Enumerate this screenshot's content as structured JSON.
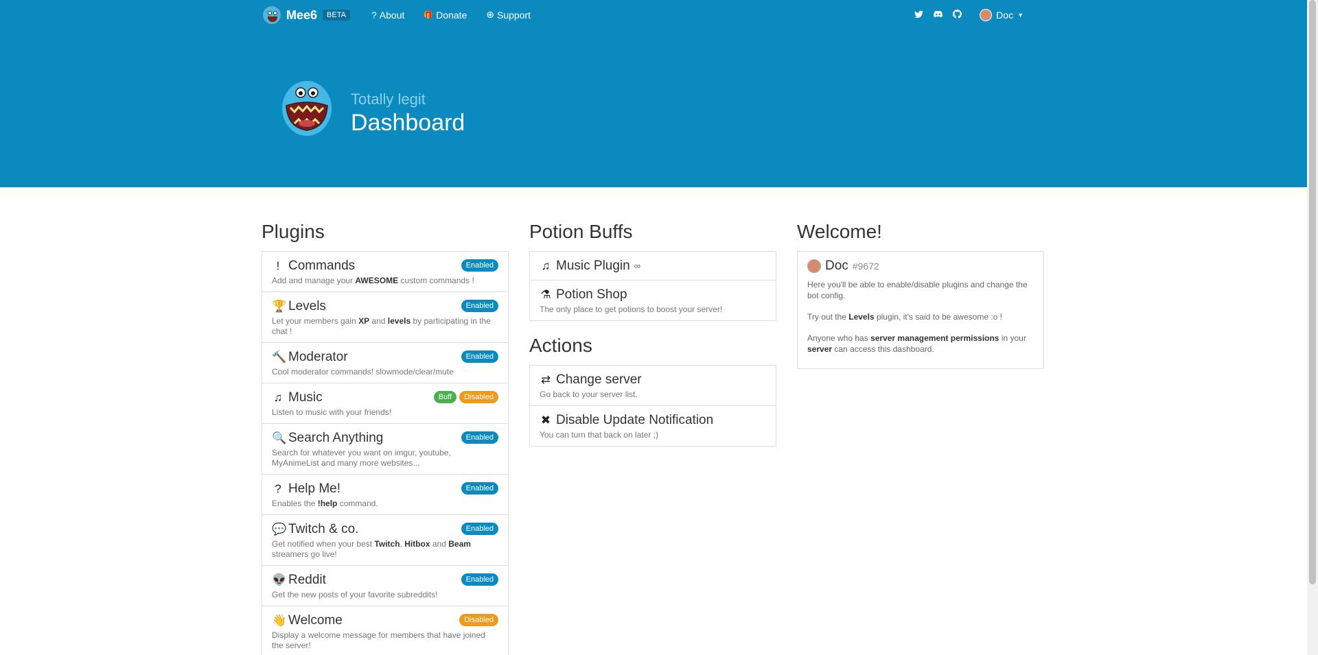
{
  "nav": {
    "brand": "Mee6",
    "beta": "BETA",
    "links": [
      {
        "icon": "?",
        "label": "About"
      },
      {
        "icon": "🎁",
        "label": "Donate"
      },
      {
        "icon": "⊕",
        "label": "Support"
      }
    ],
    "social_icons": [
      "twitter-icon",
      "discord-icon",
      "github-icon"
    ],
    "user": "Doc"
  },
  "hero": {
    "subtitle": "Totally legit",
    "title": "Dashboard"
  },
  "plugins": {
    "heading": "Plugins",
    "items": [
      {
        "icon": "!",
        "name": "Commands",
        "badges": [
          "Enabled"
        ],
        "desc_parts": [
          "Add and manage your ",
          "AWESOME",
          " custom commands !"
        ]
      },
      {
        "icon": "🏆",
        "name": "Levels",
        "badges": [
          "Enabled"
        ],
        "desc_parts": [
          "Let your members gain ",
          "XP",
          " and ",
          "levels",
          " by participating in the chat !"
        ]
      },
      {
        "icon": "🔨",
        "name": "Moderator",
        "badges": [
          "Enabled"
        ],
        "desc_parts": [
          "Cool moderator commands! slowmode/clear/mute"
        ]
      },
      {
        "icon": "♫",
        "name": "Music",
        "badges": [
          "Buff",
          "Disabled"
        ],
        "desc_parts": [
          "Listen to music with your friends!"
        ]
      },
      {
        "icon": "🔍",
        "name": "Search Anything",
        "badges": [
          "Enabled"
        ],
        "desc_parts": [
          "Search for whatever you want on imgur, youtube, MyAnimeList and many more websites..."
        ]
      },
      {
        "icon": "?",
        "name": "Help Me!",
        "badges": [
          "Enabled"
        ],
        "desc_parts": [
          "Enables the ",
          "!help",
          " command."
        ]
      },
      {
        "icon": "💬",
        "name": "Twitch & co.",
        "badges": [
          "Enabled"
        ],
        "desc_parts": [
          "Get notified when your best ",
          "Twitch",
          ", ",
          "Hitbox",
          " and ",
          "Beam",
          " streamers go live!"
        ]
      },
      {
        "icon": "👽",
        "name": "Reddit",
        "badges": [
          "Enabled"
        ],
        "desc_parts": [
          "Get the new posts of your favorite subreddits!"
        ]
      },
      {
        "icon": "👋",
        "name": "Welcome",
        "badges": [
          "Disabled"
        ],
        "desc_parts": [
          "Display a welcome message for members that have joined the server!"
        ]
      }
    ]
  },
  "potion_buffs": {
    "heading": "Potion Buffs",
    "items": [
      {
        "icon": "♫",
        "name": "Music Plugin",
        "suffix": "∞",
        "desc": ""
      },
      {
        "icon": "⚗",
        "name": "Potion Shop",
        "suffix": "",
        "desc": "The only place to get potions to boost your server!"
      }
    ]
  },
  "actions": {
    "heading": "Actions",
    "items": [
      {
        "icon": "⇄",
        "name": "Change server",
        "desc": "Go back to your server list."
      },
      {
        "icon": "✖",
        "name": "Disable Update Notification",
        "desc": "You can turn that back on later ;)"
      }
    ]
  },
  "welcome": {
    "heading": "Welcome!",
    "user": "Doc",
    "discriminator": "#9672",
    "p1": "Here you'll be able to enable/disable plugins and change the bot config.",
    "p2_parts": [
      "Try out the ",
      "Levels",
      " plugin, it's said to be awesome :o !"
    ],
    "p3_parts": [
      "Anyone who has ",
      "server management permissions",
      " in your ",
      "server",
      " can access this dashboard."
    ]
  },
  "colors": {
    "header_bg": "#0a8abf",
    "enabled": "#0a8abf",
    "disabled": "#ef9a1a",
    "buff": "#4caf50"
  }
}
